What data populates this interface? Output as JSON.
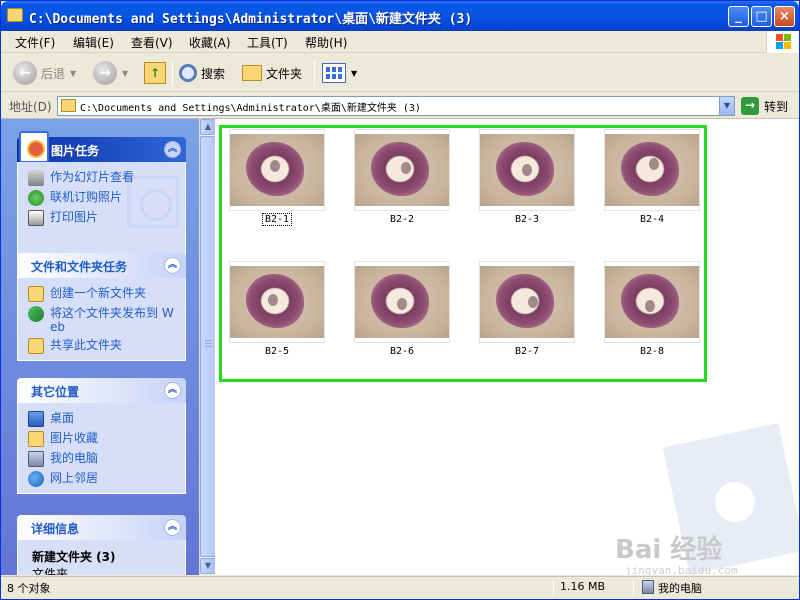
{
  "window": {
    "title": "C:\\Documents and Settings\\Administrator\\桌面\\新建文件夹 (3)",
    "controls": {
      "minimize": "_",
      "maximize": "□",
      "close": "×"
    }
  },
  "menu": {
    "items": [
      "文件(F)",
      "编辑(E)",
      "查看(V)",
      "收藏(A)",
      "工具(T)",
      "帮助(H)"
    ]
  },
  "toolbar": {
    "back_label": "后退",
    "search_label": "搜索",
    "folders_label": "文件夹"
  },
  "address": {
    "label": "地址(D)",
    "value": "C:\\Documents and Settings\\Administrator\\桌面\\新建文件夹 (3)",
    "go_label": "转到"
  },
  "tasks": {
    "picture_tasks": {
      "title": "图片任务",
      "items": [
        "作为幻灯片查看",
        "联机订购照片",
        "打印图片"
      ]
    },
    "file_tasks": {
      "title": "文件和文件夹任务",
      "items": [
        "创建一个新文件夹",
        "将这个文件夹发布到 Web",
        "共享此文件夹"
      ]
    },
    "other_places": {
      "title": "其它位置",
      "items": [
        "桌面",
        "图片收藏",
        "我的电脑",
        "网上邻居"
      ]
    },
    "details": {
      "title": "详细信息",
      "name": "新建文件夹 (3)",
      "type": "文件夹"
    }
  },
  "thumbnails": [
    {
      "label": "B2-1",
      "selected": true
    },
    {
      "label": "B2-2"
    },
    {
      "label": "B2-3"
    },
    {
      "label": "B2-4"
    },
    {
      "label": "B2-5"
    },
    {
      "label": "B2-6"
    },
    {
      "label": "B2-7"
    },
    {
      "label": "B2-8"
    }
  ],
  "watermark": {
    "brand": "Bai 经验",
    "url": "jingyan.baidu.com"
  },
  "status": {
    "count": "8 个对象",
    "size": "1.16 MB",
    "location": "我的电脑"
  },
  "colors": {
    "title_bar": "#0854e2",
    "task_pane": "#6f8fdf",
    "selection_frame": "#22dd22",
    "link": "#215dc6"
  }
}
